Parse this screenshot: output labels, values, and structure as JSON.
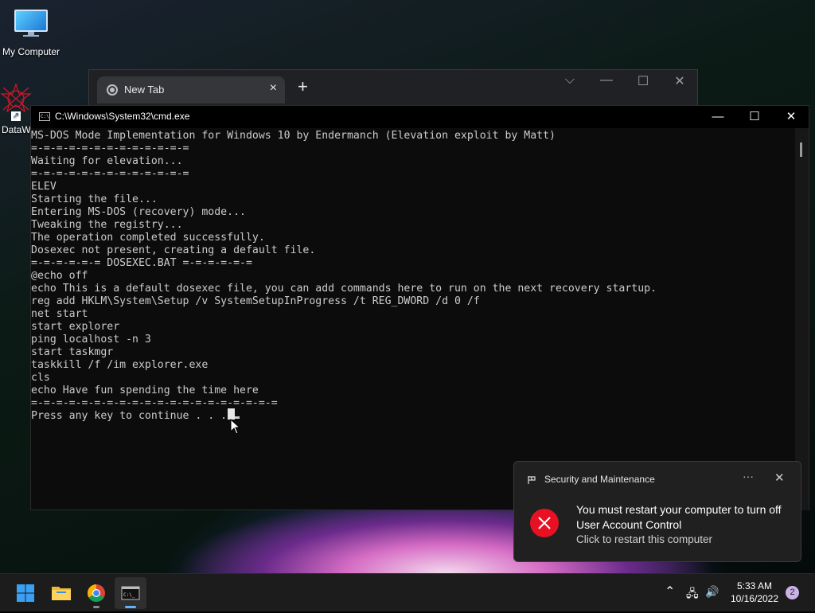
{
  "desktop": {
    "icons": [
      {
        "label": "My Computer"
      },
      {
        "label": "DataW"
      }
    ]
  },
  "chrome": {
    "tab_title": "New Tab",
    "tab_close": "×",
    "new_tab": "+",
    "btn_dropdown": "⌵",
    "btn_minimize": "—",
    "btn_maximize": "☐",
    "btn_close": "✕"
  },
  "cmd": {
    "icon_text": "C:\\",
    "title": "C:\\Windows\\System32\\cmd.exe",
    "btn_minimize": "—",
    "btn_maximize": "☐",
    "btn_close": "✕",
    "lines": [
      "MS-DOS Mode Implementation for Windows 10 by Endermanch (Elevation exploit by Matt)",
      "",
      "=-=-=-=-=-=-=-=-=-=-=-=-=",
      "Waiting for elevation...",
      "=-=-=-=-=-=-=-=-=-=-=-=-=",
      "ELEV",
      "",
      "Starting the file...",
      "Entering MS-DOS (recovery) mode...",
      "",
      "Tweaking the registry...",
      "The operation completed successfully.",
      "",
      "Dosexec not present, creating a default file.",
      "",
      "=-=-=-=-=-= DOSEXEC.BAT =-=-=-=-=-=",
      "@echo off",
      "echo This is a default dosexec file, you can add commands here to run on the next recovery startup.",
      "reg add HKLM\\System\\Setup /v SystemSetupInProgress /t REG_DWORD /d 0 /f",
      "net start",
      "start explorer",
      "ping localhost -n 3",
      "start taskmgr",
      "taskkill /f /im explorer.exe",
      "cls",
      "echo Have fun spending the time here",
      "=-=-=-=-=-=-=-=-=-=-=-=-=-=-=-=-=-=-=-=",
      "Press any key to continue . . . "
    ]
  },
  "toast": {
    "app_name": "Security and Maintenance",
    "more": "···",
    "close": "✕",
    "line1": "You must restart your computer to turn off",
    "line2": "User Account Control",
    "line3": "Click to restart this computer"
  },
  "taskbar": {
    "time": "5:33 AM",
    "date": "10/16/2022",
    "notification_count": "2",
    "chevron": "⌃",
    "network": "🖧",
    "volume": "🔊"
  },
  "colors": {
    "error": "#e81123",
    "accent": "#5fb2ff"
  }
}
